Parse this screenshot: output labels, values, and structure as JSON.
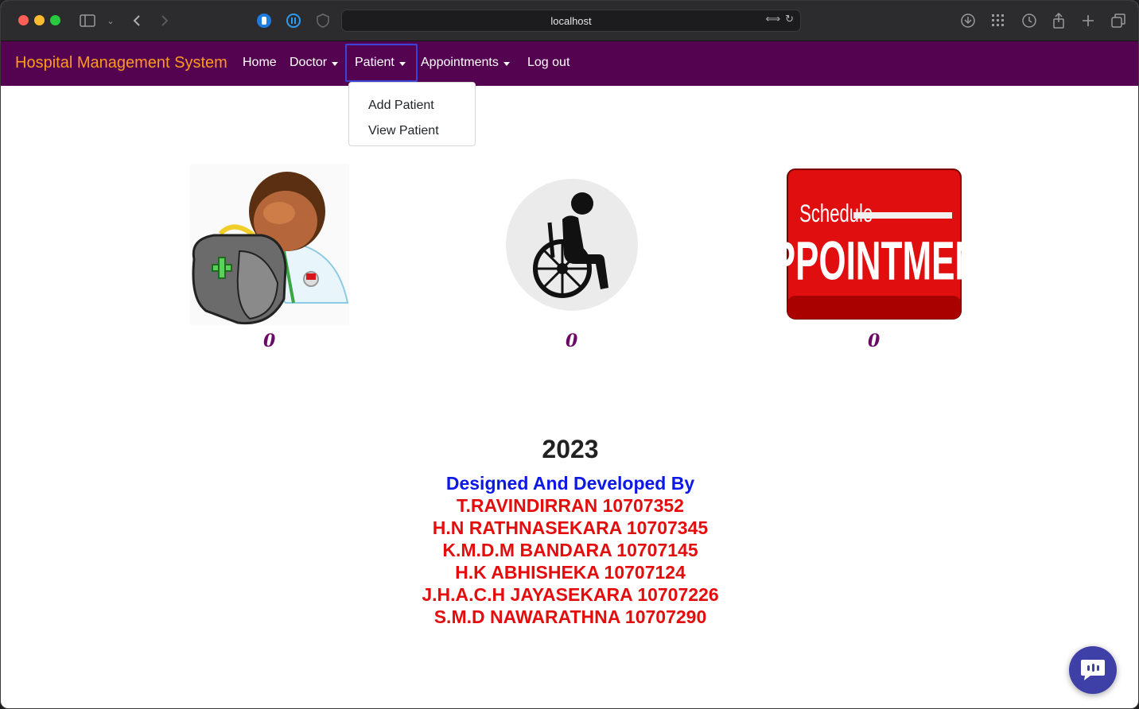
{
  "browser": {
    "url": "localhost"
  },
  "navbar": {
    "brand": "Hospital Management System",
    "items": [
      {
        "label": "Home"
      },
      {
        "label": "Doctor"
      },
      {
        "label": "Patient"
      },
      {
        "label": "Appointments"
      },
      {
        "label": "Log out"
      }
    ]
  },
  "dropdown": {
    "items": [
      {
        "label": "Add Patient"
      },
      {
        "label": "View Patient"
      }
    ]
  },
  "cards": [
    {
      "icon": "doctor-icon",
      "count": "0"
    },
    {
      "icon": "wheelchair-icon",
      "count": "0"
    },
    {
      "icon": "schedule-appointment-icon",
      "count": "0",
      "image_text_top": "Schedule",
      "image_text_main": "APPOINTMENT"
    }
  ],
  "footer": {
    "year": "2023",
    "designed_by": "Designed And Developed By",
    "developers": [
      "T.RAVINDIRRAN 10707352",
      "H.N RATHNASEKARA 10707345",
      "K.M.D.M BANDARA 10707145",
      "H.K ABHISHEKA 10707124",
      "J.H.A.C.H JAYASEKARA 10707226",
      "S.M.D NAWARATHNA 10707290"
    ]
  },
  "colors": {
    "navbar": "#540350",
    "brand": "#ff9a1f",
    "count": "#6b0a66",
    "designed_by": "#0b18e6",
    "developers": "#e30d0d"
  }
}
